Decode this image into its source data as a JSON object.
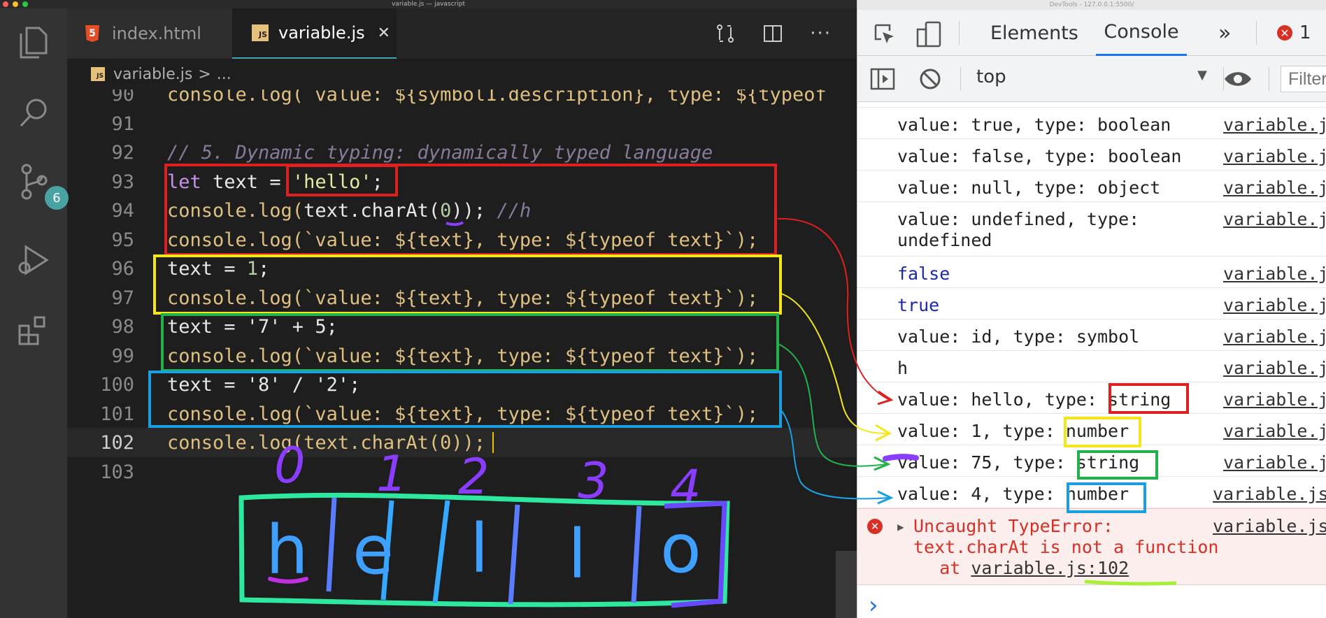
{
  "window": {
    "title": "variable.js — javascript",
    "devtools_title": "DevTools - 127.0.0.1:5500/"
  },
  "activity": {
    "scm_badge": "6"
  },
  "tabs": [
    {
      "label": "index.html",
      "icon": "html5-icon"
    },
    {
      "label": "variable.js",
      "icon": "js-icon",
      "close": "✕"
    }
  ],
  "breadcrumb": {
    "file": "variable.js",
    "sep": ">",
    "rest": "..."
  },
  "lines": {
    "n90": "90",
    "l90a": "console.log(`value: ${symbol1.description}, type: ${typeof",
    "n91": "91",
    "n92": "92",
    "l92": "// 5. Dynamic typing: dynamically typed language",
    "n93": "93",
    "l93a": "let",
    "l93b": " text = ",
    "l93c": "'hello'",
    "l93d": ";",
    "n94": "94",
    "l94a": "console.log(",
    "l94b": "text.charAt(",
    "l94c": "0",
    "l94d": ")); ",
    "l94e": "//h",
    "n95": "95",
    "l95": "console.log(`value: ${text}, type: ${typeof text}`);",
    "n96": "96",
    "l96a": "text = ",
    "l96b": "1",
    "l96c": ";",
    "n97": "97",
    "l97": "console.log(`value: ${text}, type: ${typeof text}`);",
    "n98": "98",
    "l98": "text = '7' + 5;",
    "n99": "99",
    "l99": "console.log(`value: ${text}, type: ${typeof text}`);",
    "n100": "100",
    "l100": "text = '8' / '2';",
    "n101": "101",
    "l101": "console.log(`value: ${text}, type: ${typeof text}`);",
    "n102": "102",
    "l102": "console.log(text.charAt(0));",
    "n103": "103"
  },
  "devtools": {
    "tabs": {
      "elements": "Elements",
      "console": "Console",
      "more": "»",
      "errors": "1"
    },
    "context": "top",
    "filter_placeholder": "Filter"
  },
  "console": {
    "rows": [
      {
        "msg": "value: true, type: boolean",
        "src": "variable.j"
      },
      {
        "msg": "value: false, type: boolean",
        "src": "variable.j"
      },
      {
        "msg": "value: null, type: object",
        "src": "variable.j"
      },
      {
        "msg": "value: undefined, type:\nundefined",
        "src": "variable.j"
      },
      {
        "msg": "false",
        "src": "variable.j"
      },
      {
        "msg": "true",
        "src": "variable.j"
      },
      {
        "msg": "value: id, type: symbol",
        "src": "variable.j"
      },
      {
        "msg": "h",
        "src": "variable.j"
      },
      {
        "msg": "value: hello, type: string",
        "src": "variable.j"
      },
      {
        "msg": "value: 1, type: number",
        "src": "variable.j"
      },
      {
        "msg": "value: 75, type: string",
        "src": "variable.j"
      },
      {
        "msg": "value: 4, type: number",
        "src": "variable.js"
      }
    ],
    "error": {
      "msg": "Uncaught TypeError:\ntext.charAt is not a function",
      "at": "    at ",
      "link": "variable.js:102",
      "src": "variable.js"
    },
    "prompt": "›"
  },
  "drawing": {
    "indices": [
      "0",
      "1",
      "2",
      "3",
      "4"
    ],
    "letters": [
      "h",
      "e",
      "l",
      "l",
      "o"
    ]
  },
  "colors": {
    "red": "#e02020",
    "yellow": "#f5e61c",
    "green": "#22b14c",
    "blue": "#1aa0e0",
    "purple": "#8a3dfc"
  }
}
